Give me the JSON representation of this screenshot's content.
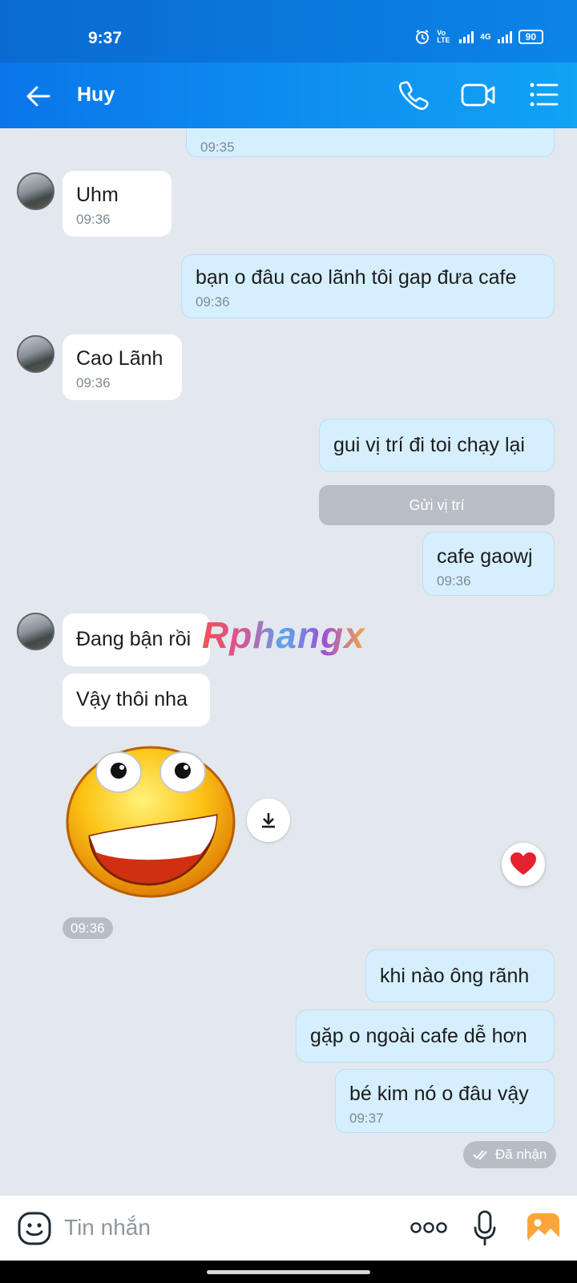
{
  "status_bar": {
    "time": "9:37",
    "volte_label": "Vo LTE",
    "network_label": "4G",
    "battery": "90"
  },
  "header": {
    "contact_name": "Huy"
  },
  "messages": {
    "m0": {
      "time": "09:35"
    },
    "m1": {
      "text": "Uhm",
      "time": "09:36"
    },
    "m2": {
      "text": "bạn o đâu cao lãnh tôi gap đưa cafe",
      "time": "09:36"
    },
    "m3": {
      "text": "Cao Lãnh",
      "time": "09:36"
    },
    "m4": {
      "text": "gui vị trí đi toi chạy lại"
    },
    "location_button": "Gửi vị trí",
    "m5": {
      "text": "cafe gaowj",
      "time": "09:36"
    },
    "m6": {
      "text": "Đang bận rồi"
    },
    "m7": {
      "text": "Vậy thôi nha"
    },
    "sticker_time": "09:36",
    "m8": {
      "text": "khi nào ông rãnh"
    },
    "m9": {
      "text": "gặp o ngoài cafe dễ hơn"
    },
    "m10": {
      "text": "bé kim nó o đâu vậy",
      "time": "09:37"
    },
    "delivery_status": "Đã nhận"
  },
  "watermark": "Rphangx",
  "composer": {
    "placeholder": "Tin nhắn"
  }
}
